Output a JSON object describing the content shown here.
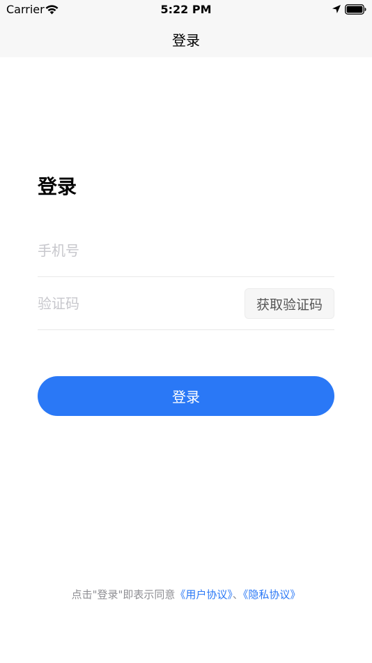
{
  "status_bar": {
    "carrier": "Carrier",
    "time": "5:22 PM"
  },
  "nav": {
    "title": "登录"
  },
  "form": {
    "heading": "登录",
    "phone_placeholder": "手机号",
    "code_placeholder": "验证码",
    "get_code_label": "获取验证码",
    "submit_label": "登录"
  },
  "agreement": {
    "prefix": "点击\"登录\"即表示同意",
    "user_agreement": "《用户协议》",
    "separator": "、",
    "privacy_policy": "《隐私协议》"
  },
  "colors": {
    "accent": "#2a78f6",
    "topbar_bg": "#f7f7f7",
    "placeholder": "#c7c7cc"
  },
  "icons": [
    "wifi-icon",
    "location-arrow-icon",
    "battery-icon"
  ]
}
